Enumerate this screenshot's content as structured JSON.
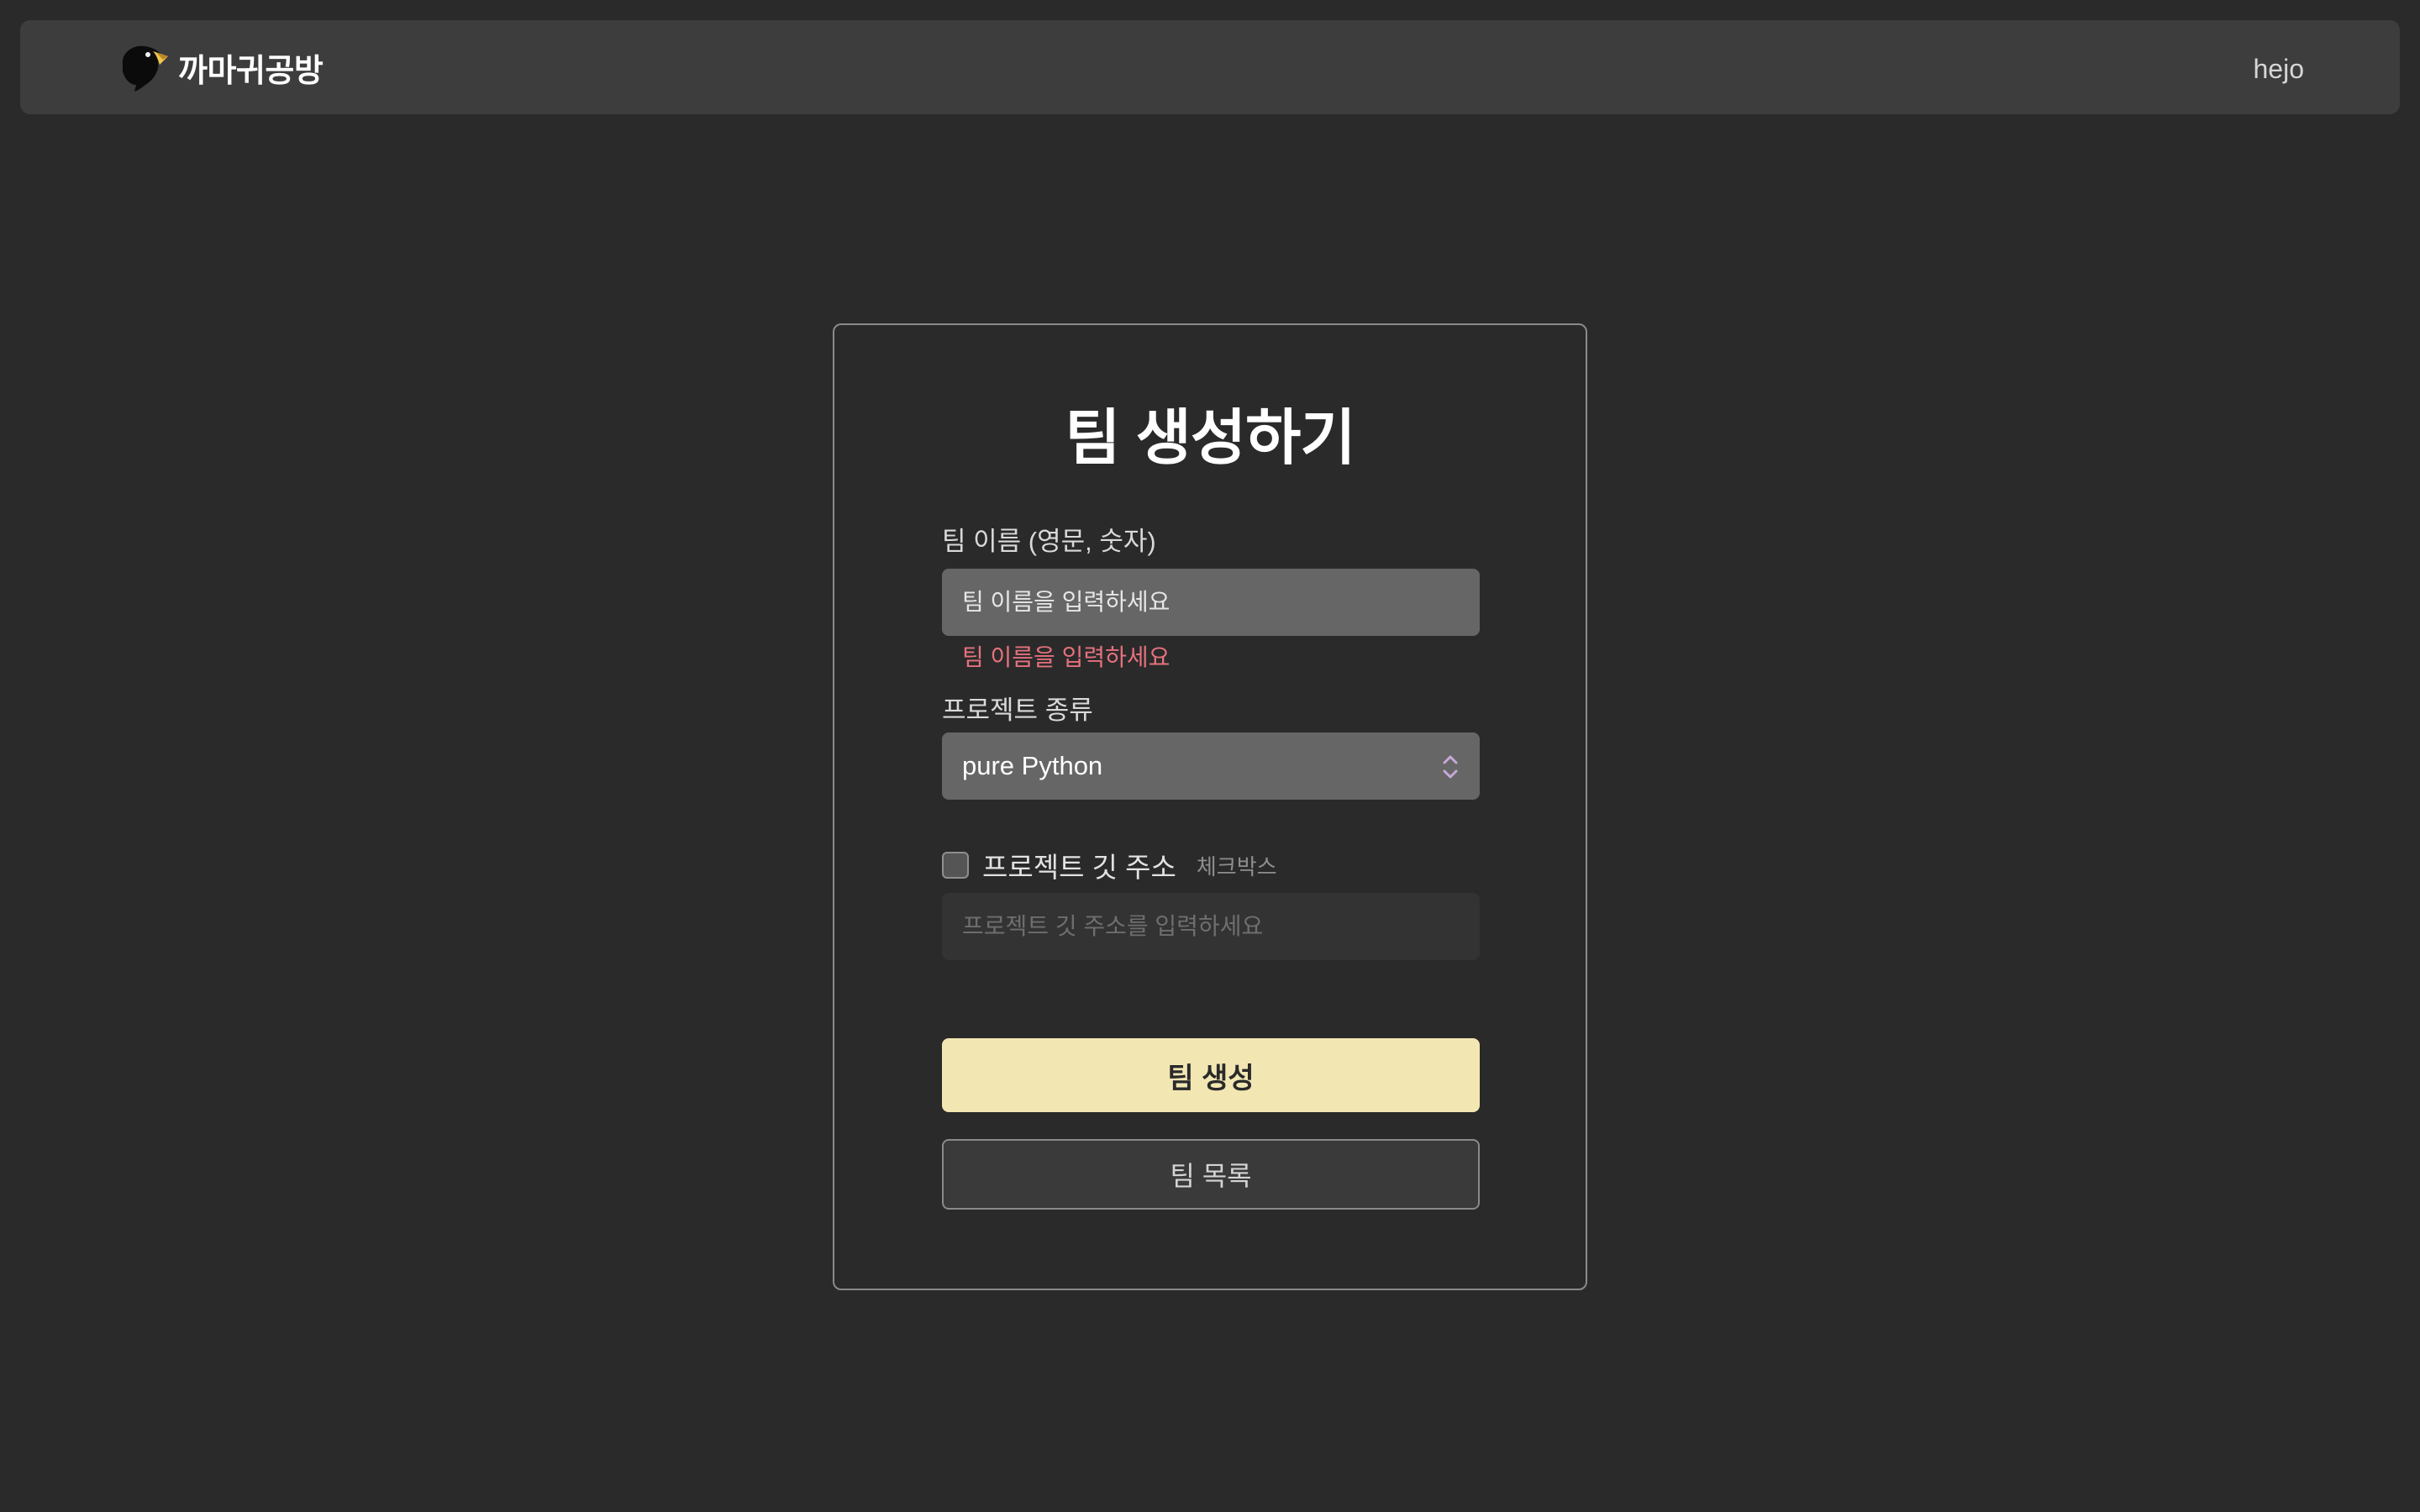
{
  "navbar": {
    "brand_name": "까마귀공방",
    "user_name": "hejo"
  },
  "form": {
    "title": "팀 생성하기",
    "team_name": {
      "label": "팀 이름 (영문, 숫자)",
      "placeholder": "팀 이름을 입력하세요",
      "value": "",
      "error": "팀 이름을 입력하세요"
    },
    "project_type": {
      "label": "프로젝트 종류",
      "selected": "pure Python"
    },
    "git_address": {
      "checkbox_checked": false,
      "label": "프로젝트 깃 주소",
      "hint": "체크박스",
      "placeholder": "프로젝트 깃 주소를 입력하세요",
      "value": ""
    },
    "submit_label": "팀 생성",
    "list_label": "팀 목록"
  },
  "colors": {
    "page_background": "#2a2a2a",
    "navbar_background": "#3d3d3d",
    "primary_button": "#f2e6b3",
    "error_text": "#e5717d",
    "logo_beak": "#f2c64d"
  },
  "icons": {
    "logo": "crow-head-icon",
    "select_arrows": "chevron-up-down-icon",
    "checkbox": "checkbox-unchecked"
  }
}
